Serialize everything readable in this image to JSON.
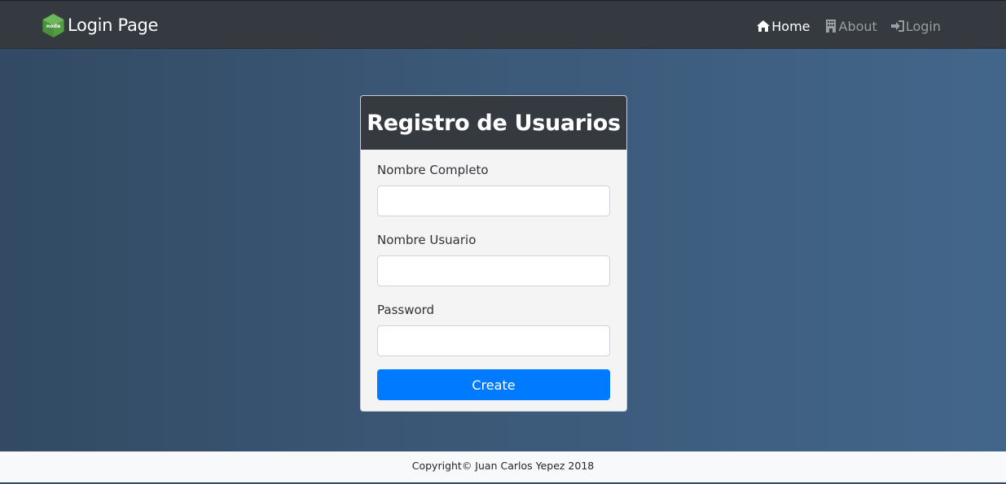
{
  "navbar": {
    "brand_logo_icon": "nodejs-hexagon-logo",
    "brand_logo_text": "node",
    "brand_title": "Login Page",
    "links": [
      {
        "label": "Home",
        "icon": "home-icon",
        "active": true
      },
      {
        "label": "About",
        "icon": "building-icon",
        "active": false
      },
      {
        "label": "Login",
        "icon": "sign-in-icon",
        "active": false
      }
    ]
  },
  "form": {
    "title": "Registro de Usuarios",
    "fields": [
      {
        "label": "Nombre Completo",
        "value": "",
        "placeholder": ""
      },
      {
        "label": "Nombre Usuario",
        "value": "",
        "placeholder": ""
      },
      {
        "label": "Password",
        "value": "",
        "placeholder": ""
      }
    ],
    "submit_label": "Create"
  },
  "footer": {
    "text": "Copyright© Juan Carlos Yepez 2018"
  },
  "colors": {
    "navbar_bg": "#343a40",
    "nav_active": "#ffffff",
    "nav_inactive": "#9a9da0",
    "primary_button": "#007bff",
    "background_gradient_start": "#324a63",
    "background_gradient_end": "#42668a",
    "card_bg": "#f4f4f4",
    "footer_bg": "#f8f9fa",
    "node_green": "#539e43"
  }
}
